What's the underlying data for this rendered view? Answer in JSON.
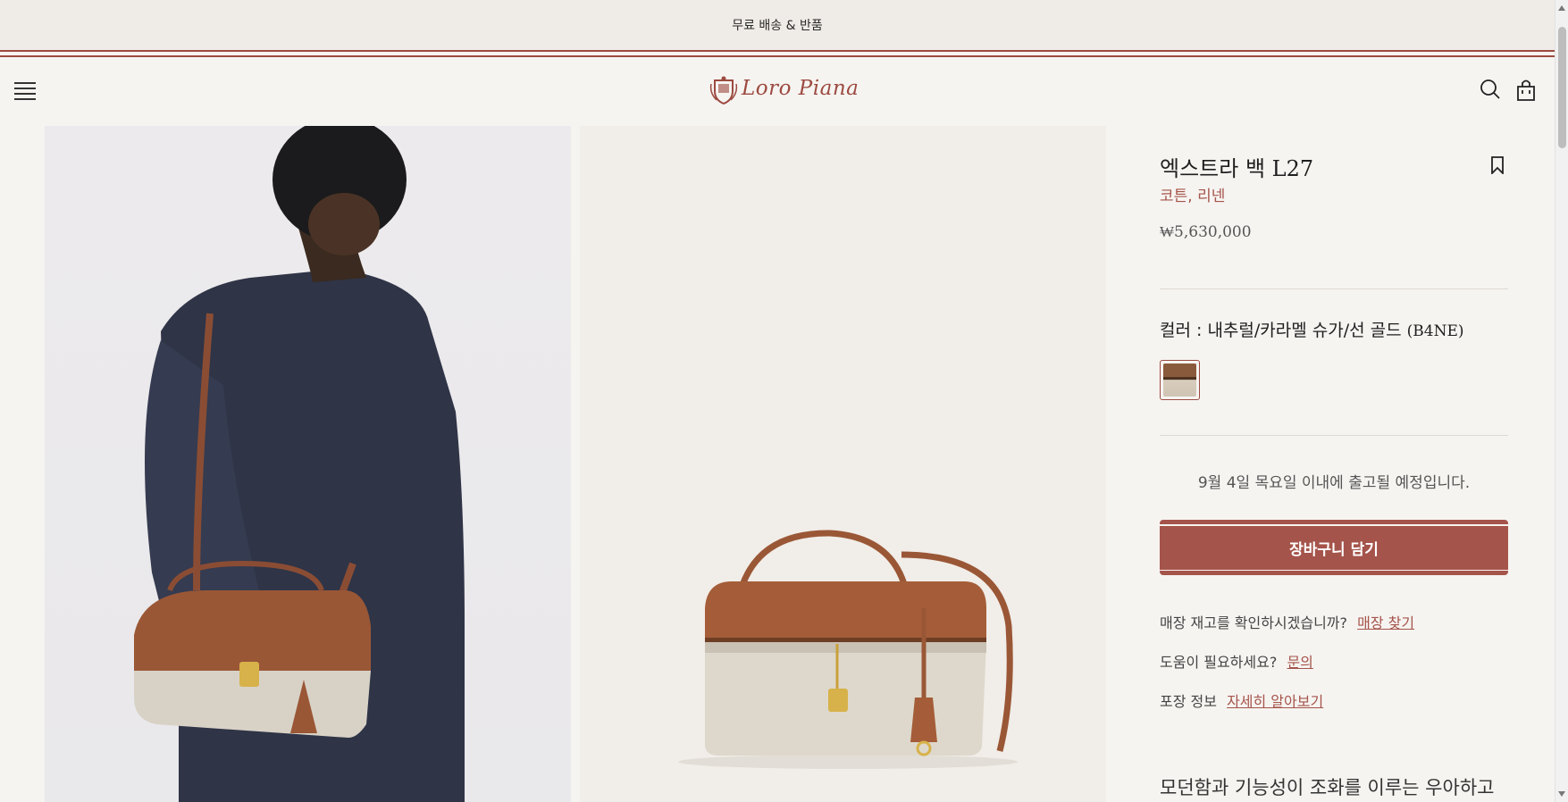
{
  "promo": {
    "text": "무료 배송 & 반품"
  },
  "header": {
    "logo_text": "Loro Piana",
    "menu_icon": "hamburger-icon",
    "search_icon": "search-icon",
    "bag_icon": "shopping-bag-icon"
  },
  "gallery": {
    "images": [
      {
        "description_icon": "model-wearing-bag-image"
      },
      {
        "description_icon": "bag-product-image"
      }
    ]
  },
  "product": {
    "title": "엑스트라 백 L27",
    "material": "코튼, 리넨",
    "price": "₩5,630,000",
    "color_label": "컬러 : 내추럴/카라멜 슈가/선 골드",
    "color_code": "(B4NE)",
    "shipping_note": "9월 4일 목요일 이내에 출고될 예정입니다.",
    "add_to_cart": "장바구니 담기",
    "stock_question": "매장 재고를 확인하시겠습니까?",
    "stock_link": "매장 찾기",
    "help_question": "도움이 필요하세요?",
    "help_link": "문의",
    "packaging_label": "포장 정보",
    "packaging_link": "자세히 알아보기",
    "description_line1": "모던함과 기능성이 조화를 이루는 우아하고 조"
  },
  "colors": {
    "brand": "#9c4a40",
    "accent": "#a5544b",
    "background": "#f6f4f1"
  }
}
